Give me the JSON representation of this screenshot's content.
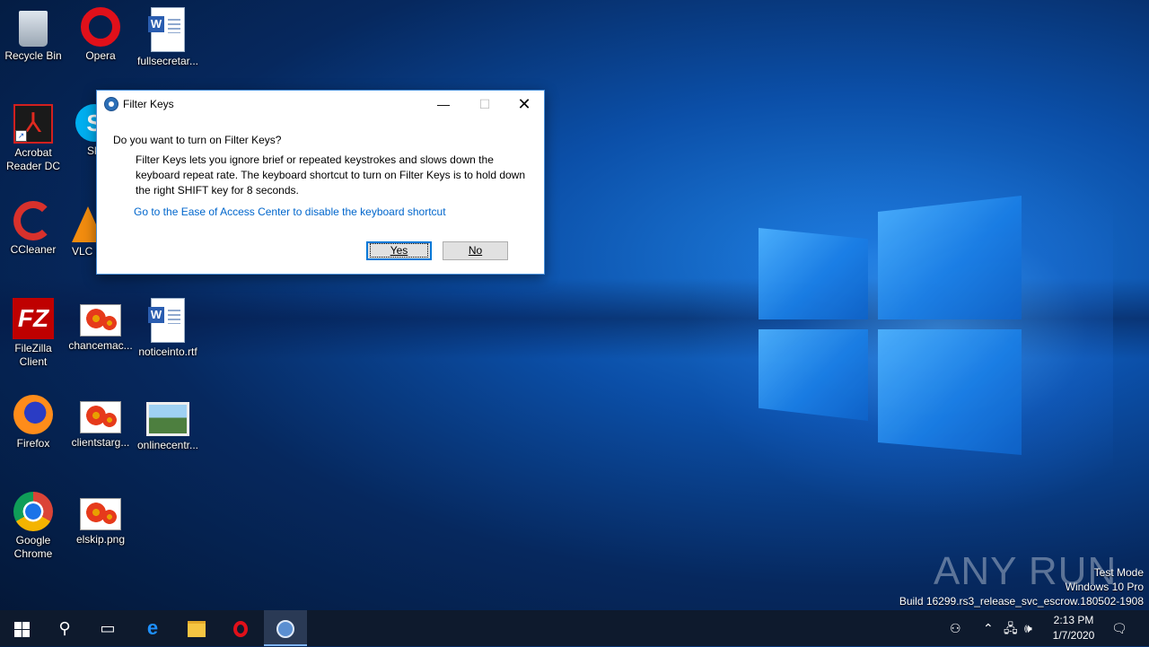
{
  "desktop": {
    "icons": [
      {
        "label": "Recycle Bin",
        "icon": "recycle-bin-icon"
      },
      {
        "label": "Opera",
        "icon": "opera-icon"
      },
      {
        "label": "fullsecretar...",
        "icon": "word-document-icon"
      },
      {
        "label": "Acrobat Reader DC",
        "icon": "acrobat-reader-icon"
      },
      {
        "label": "Sk",
        "icon": "skype-icon"
      },
      {
        "label": "CCleaner",
        "icon": "ccleaner-icon"
      },
      {
        "label": "VLC pl",
        "icon": "vlc-icon"
      },
      {
        "label": "FileZilla Client",
        "icon": "filezilla-icon"
      },
      {
        "label": "chancemac...",
        "icon": "image-file-icon"
      },
      {
        "label": "noticeinto.rtf",
        "icon": "word-document-icon"
      },
      {
        "label": "Firefox",
        "icon": "firefox-icon"
      },
      {
        "label": "clientstarg...",
        "icon": "image-file-icon"
      },
      {
        "label": "onlinecentr...",
        "icon": "landscape-image-icon"
      },
      {
        "label": "Google Chrome",
        "icon": "chrome-icon"
      },
      {
        "label": "elskip.png",
        "icon": "image-file-icon"
      }
    ]
  },
  "dialog": {
    "title": "Filter Keys",
    "question": "Do you want to turn on Filter Keys?",
    "description": "Filter Keys lets you ignore brief or repeated keystrokes and slows down the keyboard repeat rate.  The keyboard shortcut to turn on Filter Keys is to hold down the right SHIFT key for 8 seconds.",
    "link": "Go to the Ease of Access Center to disable the keyboard shortcut",
    "yes_label": "Yes",
    "no_label": "No",
    "minimize_glyph": "—",
    "maximize_glyph": "☐",
    "close_glyph": "✕"
  },
  "watermark": {
    "brand": "ANY RUN",
    "mode": "Test Mode",
    "edition": "Windows 10 Pro",
    "build": "Build 16299.rs3_release_svc_escrow.180502-1908"
  },
  "taskbar": {
    "clock_time": "2:13 PM",
    "clock_date": "1/7/2020",
    "items": [
      "start-icon",
      "search-icon",
      "task-view-icon",
      "edge-icon",
      "file-explorer-icon",
      "opera-icon",
      "ease-of-access-icon"
    ]
  },
  "colors": {
    "link": "#0066cc",
    "taskbar": "#0e1a2d",
    "dialog_border": "#4a90d9"
  }
}
